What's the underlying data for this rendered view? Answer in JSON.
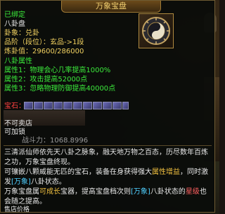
{
  "title": "万象宝盘",
  "bind_status": "已绑定",
  "item_name": "八卦盘",
  "trigram": "卦象：兑卦",
  "grade": "品阶（段位）：玄品->1段",
  "refine_value": "炼卦值：29600/286000",
  "bagua_attr_header": "八卦属性",
  "attributes": [
    "属性1：物理会心几率提高1000%",
    "属性2：攻击提高52000点",
    "属性3：忽略物理防御提高40000点"
  ],
  "gem_label": "宝石：",
  "gem_slot_count": 11,
  "cannot_sell": "不可卖店",
  "can_repair": "可加锁",
  "power_value": "战斗力：1068.8996",
  "description": {
    "line1": "三清派仙师依先天八卦之脉象，融天地万物之百态，历尽数年百炼之功，万象宝盘终现。",
    "line2_a": "可镶嵌八颗威能无匹的宝石，装备在身获得强大",
    "line2_kw": "属性增益",
    "line2_b": "，同时激发",
    "line2_kw2": "[万象]",
    "line2_c": "八卦状态。",
    "line3_a": "万象宝盘属",
    "line3_kw": "可成长",
    "line3_b": "宝器，提高宝盘档次则",
    "line3_kw2": "[万象]",
    "line3_c": "八卦状态的",
    "line3_kw3": "星级",
    "line3_d": "也会随之提高。"
  },
  "sell_price_label": "售店价格",
  "colors": {
    "title": "#f3d070",
    "green": "#3bea3b",
    "yellow": "#f0d060",
    "border": "#6e5b33"
  }
}
